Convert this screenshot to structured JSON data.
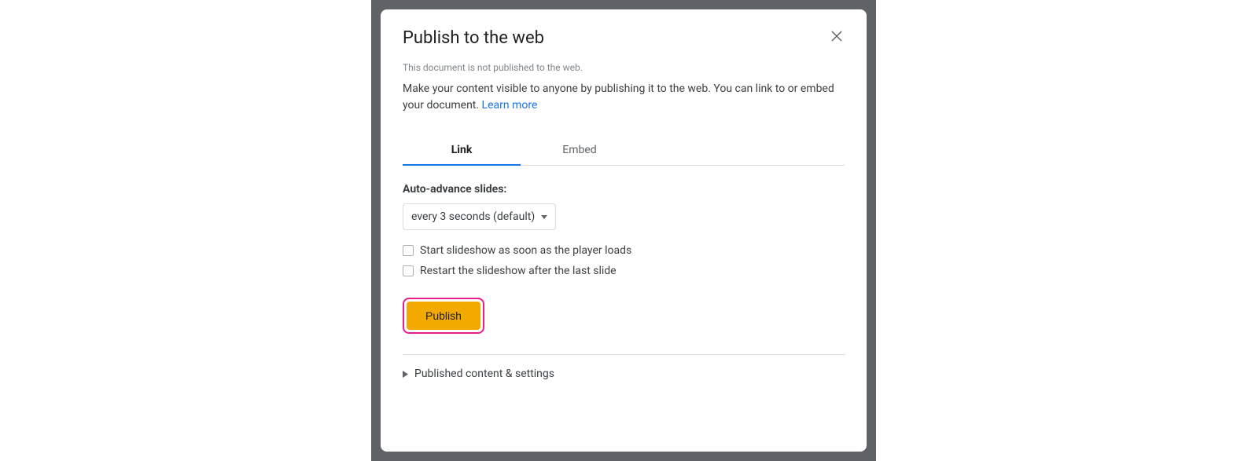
{
  "dialog": {
    "title": "Publish to the web",
    "status": "This document is not published to the web.",
    "description": "Make your content visible to anyone by publishing it to the web. You can link to or embed your document. ",
    "learn_more": "Learn more",
    "tabs": {
      "link": "Link",
      "embed": "Embed"
    },
    "auto_advance_label": "Auto-advance slides:",
    "auto_advance_value": "every 3 seconds (default)",
    "checkbox_start": "Start slideshow as soon as the player loads",
    "checkbox_restart": "Restart the slideshow after the last slide",
    "publish_button": "Publish",
    "expander": "Published content & settings"
  }
}
